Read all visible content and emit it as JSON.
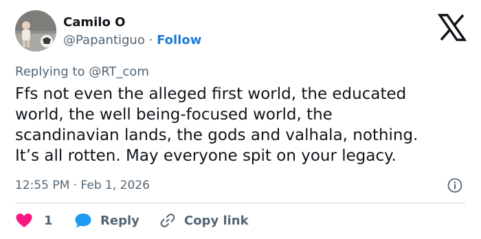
{
  "author": {
    "name": "Camilo O",
    "handle": "@Papantiguo",
    "separator": "·",
    "follow_label": "Follow"
  },
  "reply_context": {
    "prefix": "Replying to",
    "mention": "@RT_com"
  },
  "tweet": {
    "lines": [
      "Ffs not even the alleged first world, the educated",
      "world, the well being-focused world, the",
      "scandinavian lands, the gods and valhala, nothing.",
      "It’s all rotten. May everyone spit on your legacy."
    ],
    "time": "12:55 PM",
    "separator": "·",
    "date": "Feb 1, 2026"
  },
  "actions": {
    "like_count": "1",
    "reply_label": "Reply",
    "copy_link_label": "Copy link"
  },
  "icons": {
    "brand": "x-logo-icon",
    "info": "info-icon",
    "like": "heart-icon",
    "reply": "speech-bubble-icon",
    "copy": "link-icon"
  },
  "colors": {
    "text": "#0f1419",
    "secondary": "#536471",
    "link": "#1d7bd8",
    "like": "#f91880",
    "reply": "#1d9bf0",
    "divider": "#cfd9de"
  }
}
